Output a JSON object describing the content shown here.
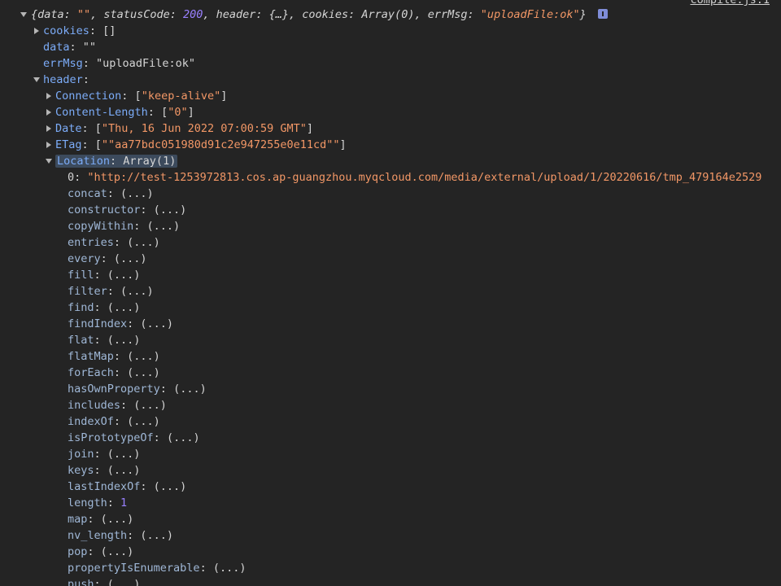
{
  "source_link": "compile.js:1",
  "root": {
    "summary_segments": [
      {
        "t": "{data: ",
        "c": "plain"
      },
      {
        "t": "\"\"",
        "c": "str"
      },
      {
        "t": ", statusCode: ",
        "c": "plain"
      },
      {
        "t": "200",
        "c": "num"
      },
      {
        "t": ", header: {…}, cookies: Array(0), errMsg: ",
        "c": "plain"
      },
      {
        "t": "\"uploadFile:ok\"",
        "c": "str"
      },
      {
        "t": "}",
        "c": "plain"
      }
    ]
  },
  "rows": [
    {
      "indent": 1,
      "toggle": "closed",
      "key": "cookies",
      "sep": ": ",
      "value": "[]",
      "vclass": "plain"
    },
    {
      "indent": 1,
      "toggle": "none",
      "key": "data",
      "sep": ": ",
      "value": "\"\"",
      "vclass": "plain"
    },
    {
      "indent": 1,
      "toggle": "none",
      "key": "errMsg",
      "sep": ": ",
      "value": "\"uploadFile:ok\"",
      "vclass": "plain"
    },
    {
      "indent": 1,
      "toggle": "open",
      "key": "header",
      "sep": ":",
      "value": "",
      "vclass": "plain"
    },
    {
      "indent": 2,
      "toggle": "closed",
      "key": "Connection",
      "sep": ": ",
      "value": "[\"keep-alive\"]",
      "vclass": "arr-str"
    },
    {
      "indent": 2,
      "toggle": "closed",
      "key": "Content-Length",
      "sep": ": ",
      "value": "[\"0\"]",
      "vclass": "arr-str"
    },
    {
      "indent": 2,
      "toggle": "closed",
      "key": "Date",
      "sep": ": ",
      "value": "[\"Thu, 16 Jun 2022 07:00:59 GMT\"]",
      "vclass": "arr-str"
    },
    {
      "indent": 2,
      "toggle": "closed",
      "key": "ETag",
      "sep": ": ",
      "value": "[\"\"aa77bdc051980d91c2e947255e0e11cd\"\"]",
      "vclass": "arr-str"
    },
    {
      "indent": 2,
      "toggle": "open",
      "key": "Location",
      "sep": ": ",
      "value": "Array(1)",
      "vclass": "plain",
      "highlight": true
    },
    {
      "indent": 3,
      "toggle": "none",
      "key": "0",
      "sep": ": ",
      "value": "\"http://test-1253972813.cos.ap-guangzhou.myqcloud.com/media/external/upload/1/20220616/tmp_479164e2529",
      "vclass": "str",
      "keyplain": true
    },
    {
      "indent": 3,
      "toggle": "none",
      "key": "concat",
      "sep": ": ",
      "value": "(...)",
      "vclass": "plain",
      "dim": true
    },
    {
      "indent": 3,
      "toggle": "none",
      "key": "constructor",
      "sep": ": ",
      "value": "(...)",
      "vclass": "plain",
      "dim": true
    },
    {
      "indent": 3,
      "toggle": "none",
      "key": "copyWithin",
      "sep": ": ",
      "value": "(...)",
      "vclass": "plain",
      "dim": true
    },
    {
      "indent": 3,
      "toggle": "none",
      "key": "entries",
      "sep": ": ",
      "value": "(...)",
      "vclass": "plain",
      "dim": true
    },
    {
      "indent": 3,
      "toggle": "none",
      "key": "every",
      "sep": ": ",
      "value": "(...)",
      "vclass": "plain",
      "dim": true
    },
    {
      "indent": 3,
      "toggle": "none",
      "key": "fill",
      "sep": ": ",
      "value": "(...)",
      "vclass": "plain",
      "dim": true
    },
    {
      "indent": 3,
      "toggle": "none",
      "key": "filter",
      "sep": ": ",
      "value": "(...)",
      "vclass": "plain",
      "dim": true
    },
    {
      "indent": 3,
      "toggle": "none",
      "key": "find",
      "sep": ": ",
      "value": "(...)",
      "vclass": "plain",
      "dim": true
    },
    {
      "indent": 3,
      "toggle": "none",
      "key": "findIndex",
      "sep": ": ",
      "value": "(...)",
      "vclass": "plain",
      "dim": true
    },
    {
      "indent": 3,
      "toggle": "none",
      "key": "flat",
      "sep": ": ",
      "value": "(...)",
      "vclass": "plain",
      "dim": true
    },
    {
      "indent": 3,
      "toggle": "none",
      "key": "flatMap",
      "sep": ": ",
      "value": "(...)",
      "vclass": "plain",
      "dim": true
    },
    {
      "indent": 3,
      "toggle": "none",
      "key": "forEach",
      "sep": ": ",
      "value": "(...)",
      "vclass": "plain",
      "dim": true
    },
    {
      "indent": 3,
      "toggle": "none",
      "key": "hasOwnProperty",
      "sep": ": ",
      "value": "(...)",
      "vclass": "plain",
      "dim": true
    },
    {
      "indent": 3,
      "toggle": "none",
      "key": "includes",
      "sep": ": ",
      "value": "(...)",
      "vclass": "plain",
      "dim": true
    },
    {
      "indent": 3,
      "toggle": "none",
      "key": "indexOf",
      "sep": ": ",
      "value": "(...)",
      "vclass": "plain",
      "dim": true
    },
    {
      "indent": 3,
      "toggle": "none",
      "key": "isPrototypeOf",
      "sep": ": ",
      "value": "(...)",
      "vclass": "plain",
      "dim": true
    },
    {
      "indent": 3,
      "toggle": "none",
      "key": "join",
      "sep": ": ",
      "value": "(...)",
      "vclass": "plain",
      "dim": true
    },
    {
      "indent": 3,
      "toggle": "none",
      "key": "keys",
      "sep": ": ",
      "value": "(...)",
      "vclass": "plain",
      "dim": true
    },
    {
      "indent": 3,
      "toggle": "none",
      "key": "lastIndexOf",
      "sep": ": ",
      "value": "(...)",
      "vclass": "plain",
      "dim": true
    },
    {
      "indent": 3,
      "toggle": "none",
      "key": "length",
      "sep": ": ",
      "value": "1",
      "vclass": "num",
      "dim": true
    },
    {
      "indent": 3,
      "toggle": "none",
      "key": "map",
      "sep": ": ",
      "value": "(...)",
      "vclass": "plain",
      "dim": true
    },
    {
      "indent": 3,
      "toggle": "none",
      "key": "nv_length",
      "sep": ": ",
      "value": "(...)",
      "vclass": "plain",
      "dim": true
    },
    {
      "indent": 3,
      "toggle": "none",
      "key": "pop",
      "sep": ": ",
      "value": "(...)",
      "vclass": "plain",
      "dim": true
    },
    {
      "indent": 3,
      "toggle": "none",
      "key": "propertyIsEnumerable",
      "sep": ": ",
      "value": "(...)",
      "vclass": "plain",
      "dim": true
    },
    {
      "indent": 3,
      "toggle": "none",
      "key": "push",
      "sep": ": ",
      "value": "(...)",
      "vclass": "plain",
      "dim": true
    }
  ]
}
